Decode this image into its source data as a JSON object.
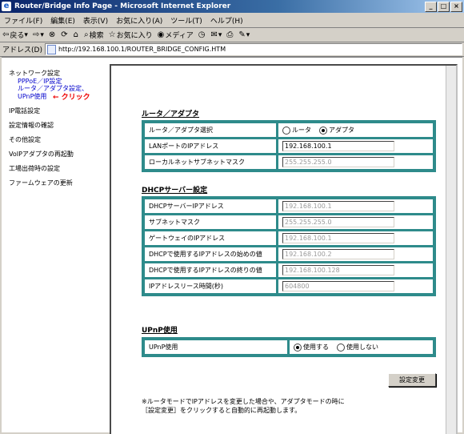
{
  "window": {
    "title": "Router/Bridge Info Page - Microsoft Internet Explorer"
  },
  "menubar": {
    "items": [
      "ファイル(F)",
      "編集(E)",
      "表示(V)",
      "お気に入り(A)",
      "ツール(T)",
      "ヘルプ(H)"
    ]
  },
  "toolbar": {
    "back": "戻る",
    "search": "検索",
    "favorites": "お気に入り",
    "media": "メディア"
  },
  "address": {
    "label": "アドレス(D)",
    "url": "http://192.168.100.1/ROUTER_BRIDGE_CONFIG.HTM"
  },
  "sidebar": {
    "network_settings": "ネットワーク設定",
    "pppoe": "PPPoE／IP設定",
    "router_adapter": "ルータ／アダプタ設定、",
    "upnp": "UPnP使用",
    "annotation": "← クリック",
    "items": [
      "IP電話設定",
      "設定情報の確認",
      "その他設定",
      "VoIPアダプタの再起動",
      "工場出荷時の設定",
      "ファームウェアの更新"
    ]
  },
  "section1": {
    "title": "ルータ／アダプタ",
    "select_label": "ルータ／アダプタ選択",
    "option_router": "ルータ",
    "option_adapter": "アダプタ",
    "lan_ip_label": "LANポートのIPアドレス",
    "lan_ip_value": "192.168.100.1",
    "subnet_label": "ローカルネットサブネットマスク",
    "subnet_value": "255.255.255.0"
  },
  "section2": {
    "title": "DHCPサーバー設定",
    "rows": [
      {
        "label": "DHCPサーバーIPアドレス",
        "value": "192.168.100.1"
      },
      {
        "label": "サブネットマスク",
        "value": "255.255.255.0"
      },
      {
        "label": "ゲートウェイのIPアドレス",
        "value": "192.168.100.1"
      },
      {
        "label": "DHCPで使用するIPアドレスの始めの値",
        "value": "192.168.100.2"
      },
      {
        "label": "DHCPで使用するIPアドレスの終りの値",
        "value": "192.168.100.128"
      },
      {
        "label": "IPアドレスリース時間(秒)",
        "value": "604800"
      }
    ]
  },
  "section3": {
    "title": "UPnP使用",
    "label": "UPnP使用",
    "option_use": "使用する",
    "option_nouse": "使用しない"
  },
  "submit_label": "設定変更",
  "note": {
    "line1": "※ルータモードでIPアドレスを変更した場合や、アダプタモードの時に",
    "line2": "［設定変更］をクリックすると自動的に再起動します。"
  }
}
